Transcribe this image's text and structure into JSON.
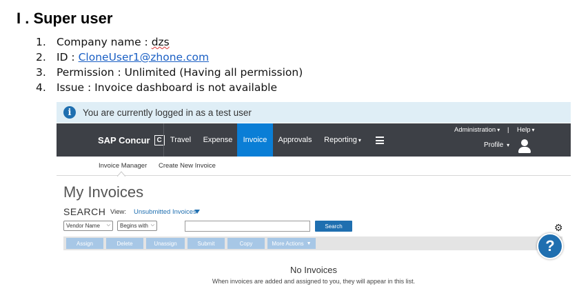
{
  "document": {
    "heading": "I . Super user",
    "items": [
      {
        "num": "1.",
        "label": "Company name : ",
        "value": "dzs"
      },
      {
        "num": "2.",
        "label": "ID : ",
        "value": "CloneUser1@zhone.com"
      },
      {
        "num": "3.",
        "label": "Permission : Unlimited (Having all permission)",
        "value": ""
      },
      {
        "num": "4.",
        "label": "Issue : Invoice dashboard is not available",
        "value": ""
      }
    ]
  },
  "app": {
    "banner": {
      "icon": "info-icon",
      "text": "You are currently logged in as a test user"
    },
    "brand": {
      "name": "SAP Concur",
      "logo_letter": "C"
    },
    "nav": {
      "items": [
        "Travel",
        "Expense",
        "Invoice",
        "Approvals",
        "Reporting"
      ],
      "active": "Invoice",
      "caret": "▾",
      "administration": "Administration",
      "separator": "|",
      "help": "Help",
      "profile": "Profile"
    },
    "subnav": {
      "items": [
        "Invoice Manager",
        "Create New Invoice"
      ]
    },
    "page_title": "My Invoices",
    "search": {
      "label": "SEARCH",
      "view_label": "View:",
      "view_value": "Unsubmitted Invoices",
      "field_select": "Vendor Name",
      "operator_select": "Begins with",
      "input_value": "",
      "button": "Search"
    },
    "actions": [
      "Assign",
      "Delete",
      "Unassign",
      "Submit",
      "Copy",
      "More Actions"
    ],
    "help_button": "?",
    "empty_state": {
      "title": "No Invoices",
      "description": "When invoices are added and assigned to you, they will appear in this list."
    },
    "colors": {
      "nav_bg": "#3d4046",
      "active_tab": "#0a7ed6",
      "accent": "#1f6fb0",
      "banner_bg": "#dfeef6",
      "disabled_button": "#a7c7e6"
    }
  }
}
